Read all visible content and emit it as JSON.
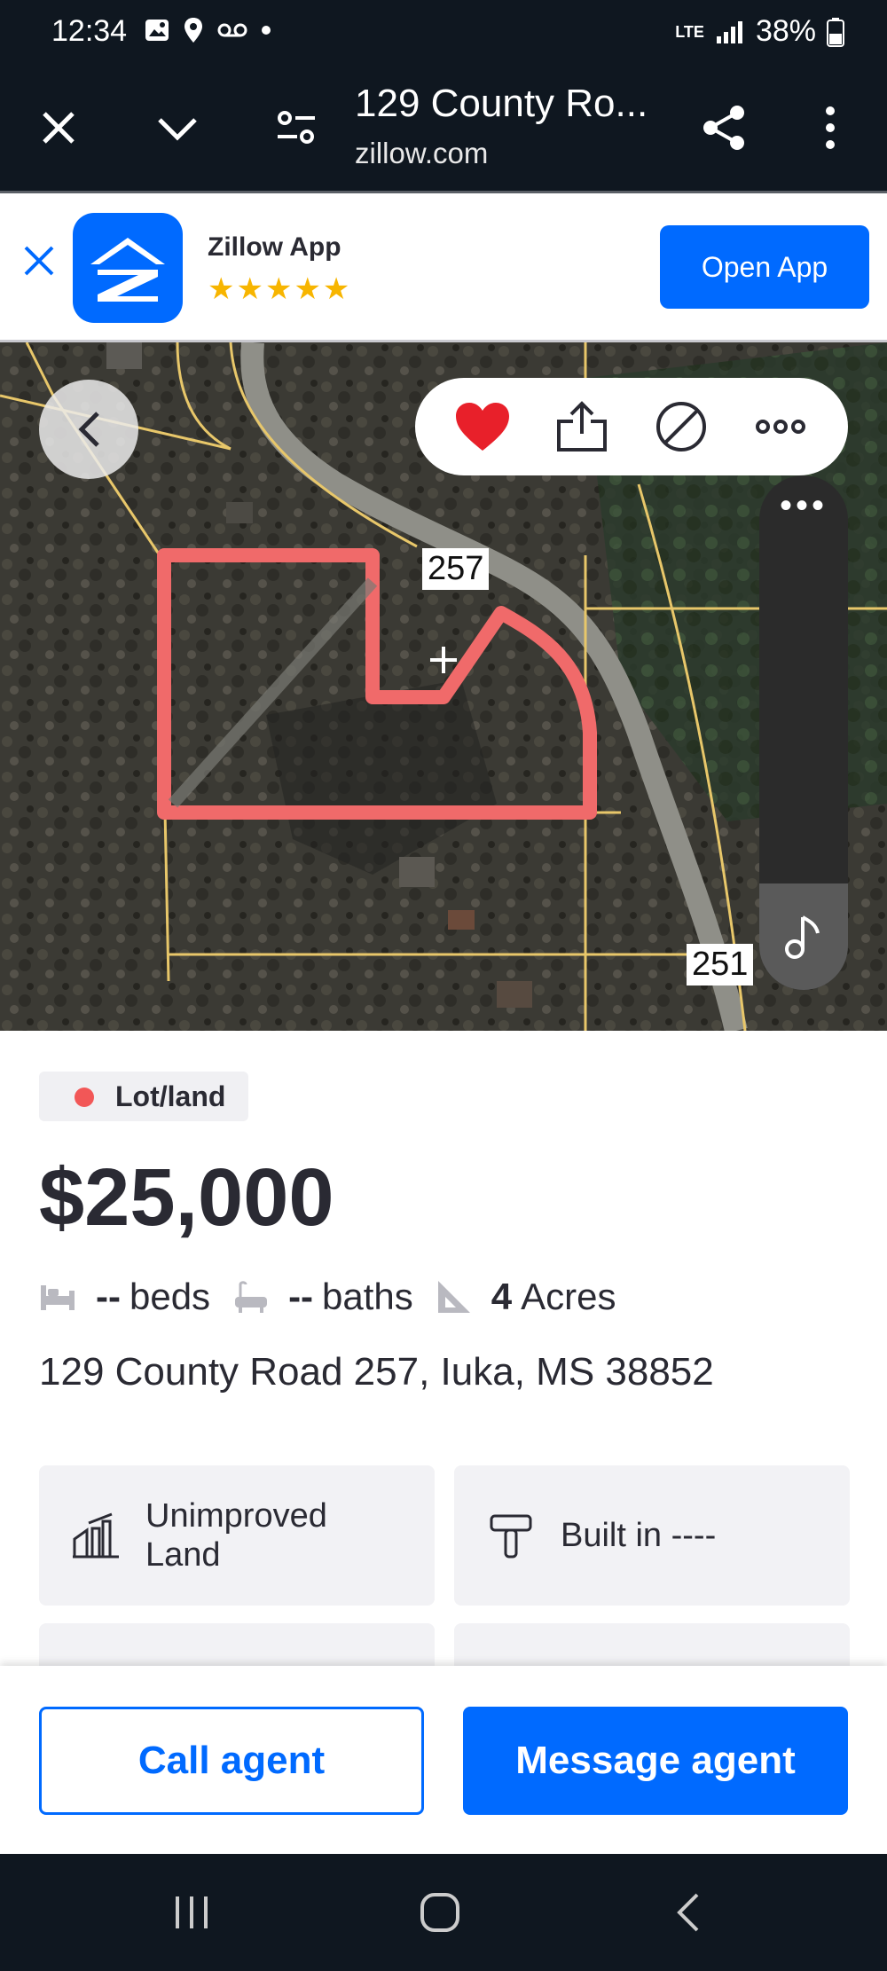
{
  "status_bar": {
    "time": "12:34",
    "battery": "38%",
    "network": "LTE"
  },
  "browser": {
    "title": "129 County Ro...",
    "url": "zillow.com"
  },
  "app_banner": {
    "app_name": "Zillow App",
    "stars": "★★★★★",
    "open_label": "Open App"
  },
  "map": {
    "parcel_labels": [
      "257",
      "251"
    ],
    "more_dots": "•••"
  },
  "listing": {
    "type_tag": "Lot/land",
    "price": "$25,000",
    "beds_value": "--",
    "beds_label": "beds",
    "baths_value": "--",
    "baths_label": "baths",
    "acres_value": "4",
    "acres_label": "Acres",
    "address": "129 County Road 257, Iuka, MS 38852",
    "cards": [
      {
        "label_line1": "Unimproved",
        "label_line2": "Land"
      },
      {
        "label_line1": "Built in ----",
        "label_line2": ""
      }
    ]
  },
  "cta": {
    "call_label": "Call agent",
    "message_label": "Message agent"
  },
  "colors": {
    "brand_blue": "#006aff",
    "status_red": "#f25757",
    "favorite_red": "#e8202a",
    "dark_bar": "#0f1720"
  }
}
